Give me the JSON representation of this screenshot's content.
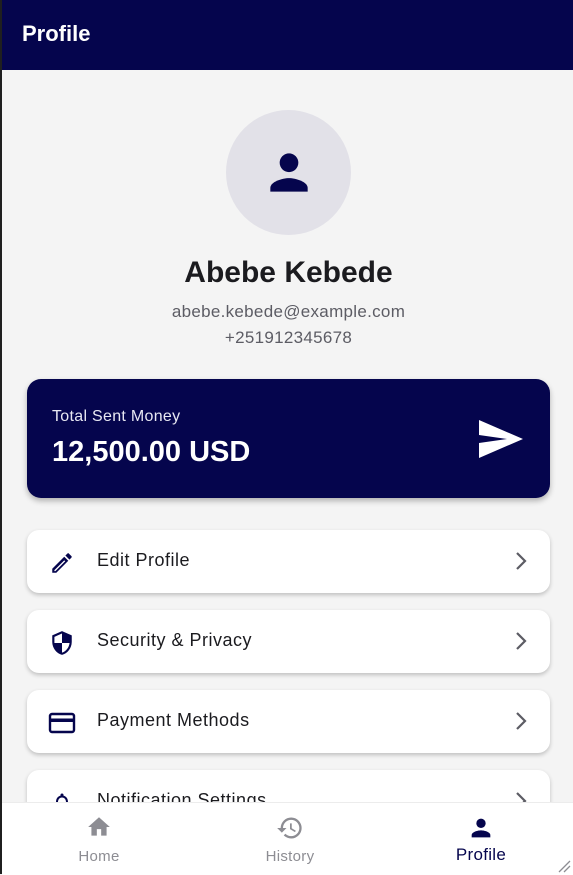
{
  "app_bar": {
    "title": "Profile"
  },
  "profile": {
    "avatar_icon": "person-icon",
    "name": "Abebe Kebede",
    "email": "abebe.kebede@example.com",
    "phone": "+251912345678"
  },
  "summary_card": {
    "label": "Total Sent Money",
    "value": "12,500.00 USD",
    "icon": "send-icon"
  },
  "menu": [
    {
      "label": "Edit Profile",
      "icon": "edit-pencil-icon"
    },
    {
      "label": "Security & Privacy",
      "icon": "shield-icon"
    },
    {
      "label": "Payment Methods",
      "icon": "credit-card-icon"
    },
    {
      "label": "Notification Settings",
      "icon": "bell-icon"
    }
  ],
  "bottom_nav": [
    {
      "label": "Home",
      "icon": "home-icon",
      "active": false
    },
    {
      "label": "History",
      "icon": "history-icon",
      "active": false
    },
    {
      "label": "Profile",
      "icon": "person-icon",
      "active": true
    }
  ],
  "colors": {
    "primary": "#05054d",
    "background": "#f4f4f4",
    "avatar_bg": "#e2e1e8",
    "inactive": "#8d8d93"
  }
}
